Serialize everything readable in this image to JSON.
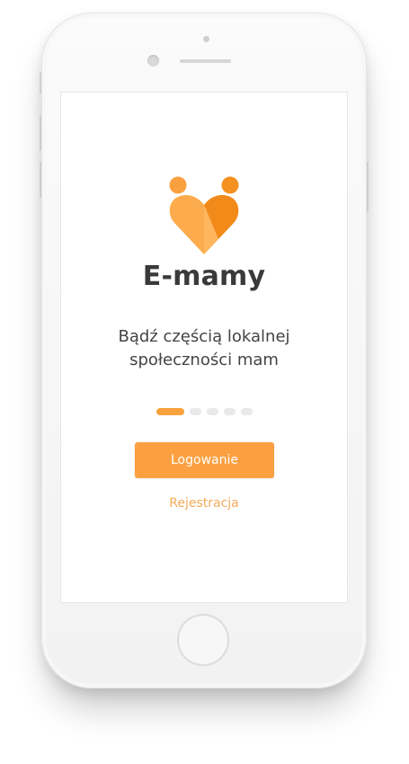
{
  "app": {
    "name": "E-mamy",
    "tagline_line1": "Bądź częścią lokalnej",
    "tagline_line2": "społeczności mam"
  },
  "carousel": {
    "page_count": 5,
    "active_index": 0
  },
  "actions": {
    "login_label": "Logowanie",
    "register_label": "Rejestracja"
  },
  "colors": {
    "accent": "#fba040",
    "accent_dark": "#f28a1a",
    "accent_light": "#fdb65e",
    "text": "#3a3a3a",
    "link": "#f7aa5a",
    "dot_inactive": "#e9e9e9"
  },
  "icons": {
    "logo": "heart-logo-icon"
  }
}
